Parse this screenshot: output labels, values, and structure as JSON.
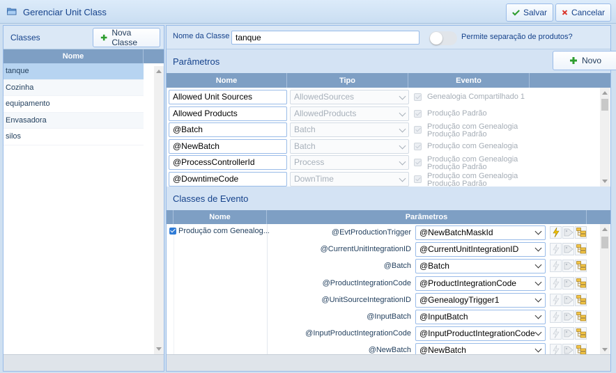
{
  "window": {
    "title": "Gerenciar Unit Class"
  },
  "toolbar": {
    "save_label": "Salvar",
    "cancel_label": "Cancelar"
  },
  "classes": {
    "header": "Classes",
    "new_button": "Nova Classe",
    "column": "Nome",
    "items": [
      {
        "name": "tanque",
        "selected": true
      },
      {
        "name": "Cozinha"
      },
      {
        "name": "equipamento"
      },
      {
        "name": "Envasadora"
      },
      {
        "name": "silos"
      }
    ]
  },
  "class_form": {
    "name_label": "Nome da Classe",
    "name_value": "tanque",
    "toggle_label": "Permite separação de produtos?",
    "toggle_on": false
  },
  "parameters": {
    "title": "Parâmetros",
    "new_button": "Novo",
    "columns": [
      "Nome",
      "Tipo",
      "Evento"
    ],
    "rows": [
      {
        "name": "Allowed Unit Sources",
        "type": "AllowedSources",
        "events": [
          "Genealogia Compartilhado 1"
        ]
      },
      {
        "name": "Allowed Products",
        "type": "AllowedProducts",
        "events": [
          "Produção Padrão"
        ]
      },
      {
        "name": "@Batch",
        "type": "Batch",
        "events": [
          "Produção com Genealogia",
          "Produção Padrão"
        ]
      },
      {
        "name": "@NewBatch",
        "type": "Batch",
        "events": [
          "Produção com Genealogia"
        ]
      },
      {
        "name": "@ProcessControllerId",
        "type": "Process",
        "events": [
          "Produção com Genealogia",
          "Produção Padrão"
        ]
      },
      {
        "name": "@DowntimeCode",
        "type": "DownTime",
        "events": [
          "Produção com Genealogia",
          "Produção Padrão"
        ]
      }
    ]
  },
  "event_classes": {
    "title": "Classes de Evento",
    "columns": [
      "Nome",
      "Parâmetros"
    ],
    "event_name": "Produção com Genealog...",
    "event_checked": true,
    "rows": [
      {
        "label": "@EvtProductionTrigger",
        "value": "@NewBatchMaskId",
        "trigger_active": true
      },
      {
        "label": "@CurrentUnitIntegrationID",
        "value": "@CurrentUnitIntegrationID"
      },
      {
        "label": "@Batch",
        "value": "@Batch"
      },
      {
        "label": "@ProductIntegrationCode",
        "value": "@ProductIntegrationCode"
      },
      {
        "label": "@UnitSourceIntegrationID",
        "value": "@GenealogyTrigger1"
      },
      {
        "label": "@InputBatch",
        "value": "@InputBatch"
      },
      {
        "label": "@InputProductIntegrationCode",
        "value": "@InputProductIntegrationCode"
      },
      {
        "label": "@NewBatch",
        "value": "@NewBatch"
      }
    ],
    "icons": [
      "lightning-icon",
      "tag-icon",
      "hierarchy-icon"
    ]
  },
  "colors": {
    "accent": "#15428b",
    "grid_header": "#7e9fc4",
    "selected_row": "#b7d4f1",
    "save_green": "#2e9d2e",
    "cancel_red": "#d9342b"
  }
}
